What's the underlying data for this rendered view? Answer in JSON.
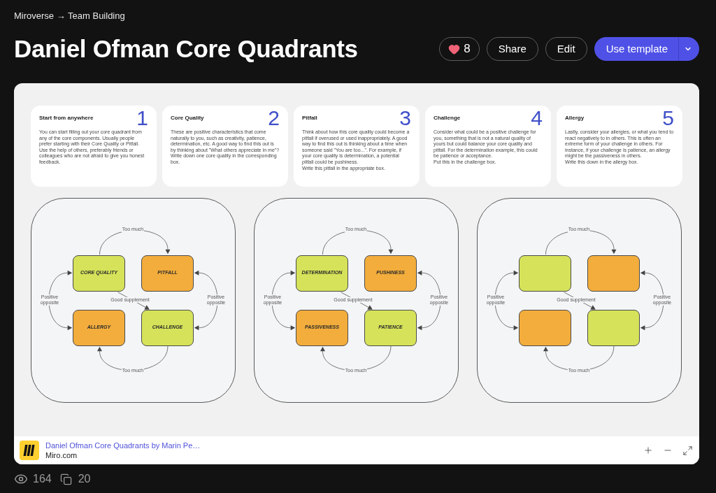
{
  "breadcrumb": "Miroverse → Team Building",
  "title": "Daniel Ofman Core Quadrants",
  "like": {
    "count": "8",
    "liked": true
  },
  "buttons": [
    {
      "label": "Share",
      "kind": "outline"
    },
    {
      "label": "Edit",
      "kind": "outline"
    },
    {
      "label": "Use template",
      "kind": "primary"
    }
  ],
  "board": {
    "cards": [
      {
        "title": "Start from anywhere",
        "number": "1",
        "body": "You can start filling out your core quadrant from any of the core components. Usually people prefer starting with their Core Quality or Pitfall. Use the help of others, preferably friends or colleagues who are not afraid to give you honest feedback."
      },
      {
        "title": "Core Quality",
        "number": "2",
        "body": "These are positive characteristics that come naturally to you, such as creativity, patience, determination, etc. A good way to find this out is by thinking about \"What others appreciate in me\"?\nWrite down one core quality in the corresponding box."
      },
      {
        "title": "Pitfall",
        "number": "3",
        "body": "Think about how this core quality could become a pitfall if overused or used inappropriately. A good way to find this out is thinking about a time when someone said \"You are too...\". For example, if your core quality is determination, a potential pitfall could be pushiness.\nWrite this pitfall in the appropriate box."
      },
      {
        "title": "Challenge",
        "number": "4",
        "body": "Consider what could be a positive challenge for you, something that is not a natural quality of yours but could balance your core quality and pitfall. For the determination example, this could be patience or acceptance.\nPut this in the challenge box."
      },
      {
        "title": "Allergy",
        "number": "5",
        "body": "Lastly, consider your allergies, or what you tend to react negatively to in others. This is often an extreme form of your challenge in others. For instance, if your challenge is patience, an allergy might be the passiveness in others.\nWrite this down in the allergy box."
      }
    ],
    "diagrams": [
      {
        "nodes": [
          {
            "label": "CORE QUALITY",
            "color": "#d6e35a"
          },
          {
            "label": "PITFALL",
            "color": "#f3ad3c"
          },
          {
            "label": "ALLERGY",
            "color": "#f3ad3c"
          },
          {
            "label": "CHALLENGE",
            "color": "#d6e35a"
          }
        ],
        "connectors": [
          {
            "kind": "top",
            "label": "Too much"
          },
          {
            "kind": "left",
            "label": "Positive opposite"
          },
          {
            "kind": "center",
            "label": "Good supplement"
          },
          {
            "kind": "right",
            "label": "Positive opposite"
          },
          {
            "kind": "bottom",
            "label": "Too much"
          }
        ]
      },
      {
        "nodes": [
          {
            "label": "DETERMINATION",
            "color": "#d6e35a"
          },
          {
            "label": "PUSHINESS",
            "color": "#f3ad3c"
          },
          {
            "label": "PASSIVENESS",
            "color": "#f3ad3c"
          },
          {
            "label": "PATIENCE",
            "color": "#d6e35a"
          }
        ],
        "connectors": [
          {
            "kind": "top",
            "label": "Too much"
          },
          {
            "kind": "left",
            "label": "Positive opposite"
          },
          {
            "kind": "center",
            "label": "Good supplement"
          },
          {
            "kind": "right",
            "label": "Positive opposite"
          },
          {
            "kind": "bottom",
            "label": "Too much"
          }
        ]
      },
      {
        "nodes": [
          {
            "color": "#d6e35a"
          },
          {
            "color": "#f3ad3c"
          },
          {
            "color": "#f3ad3c"
          },
          {
            "color": "#d6e35a"
          }
        ],
        "connectors": [
          {
            "kind": "top",
            "label": "Too much"
          },
          {
            "kind": "left",
            "label": "Positive opposite"
          },
          {
            "kind": "center",
            "label": "Good supplement"
          },
          {
            "kind": "right",
            "label": "Positive opposite"
          },
          {
            "kind": "bottom",
            "label": "Too much"
          }
        ]
      }
    ],
    "footer": {
      "link": "Daniel Ofman Core Quadrants by Marin Pe…",
      "site": "Miro.com"
    }
  },
  "stats": {
    "views": "164",
    "copies": "20"
  }
}
